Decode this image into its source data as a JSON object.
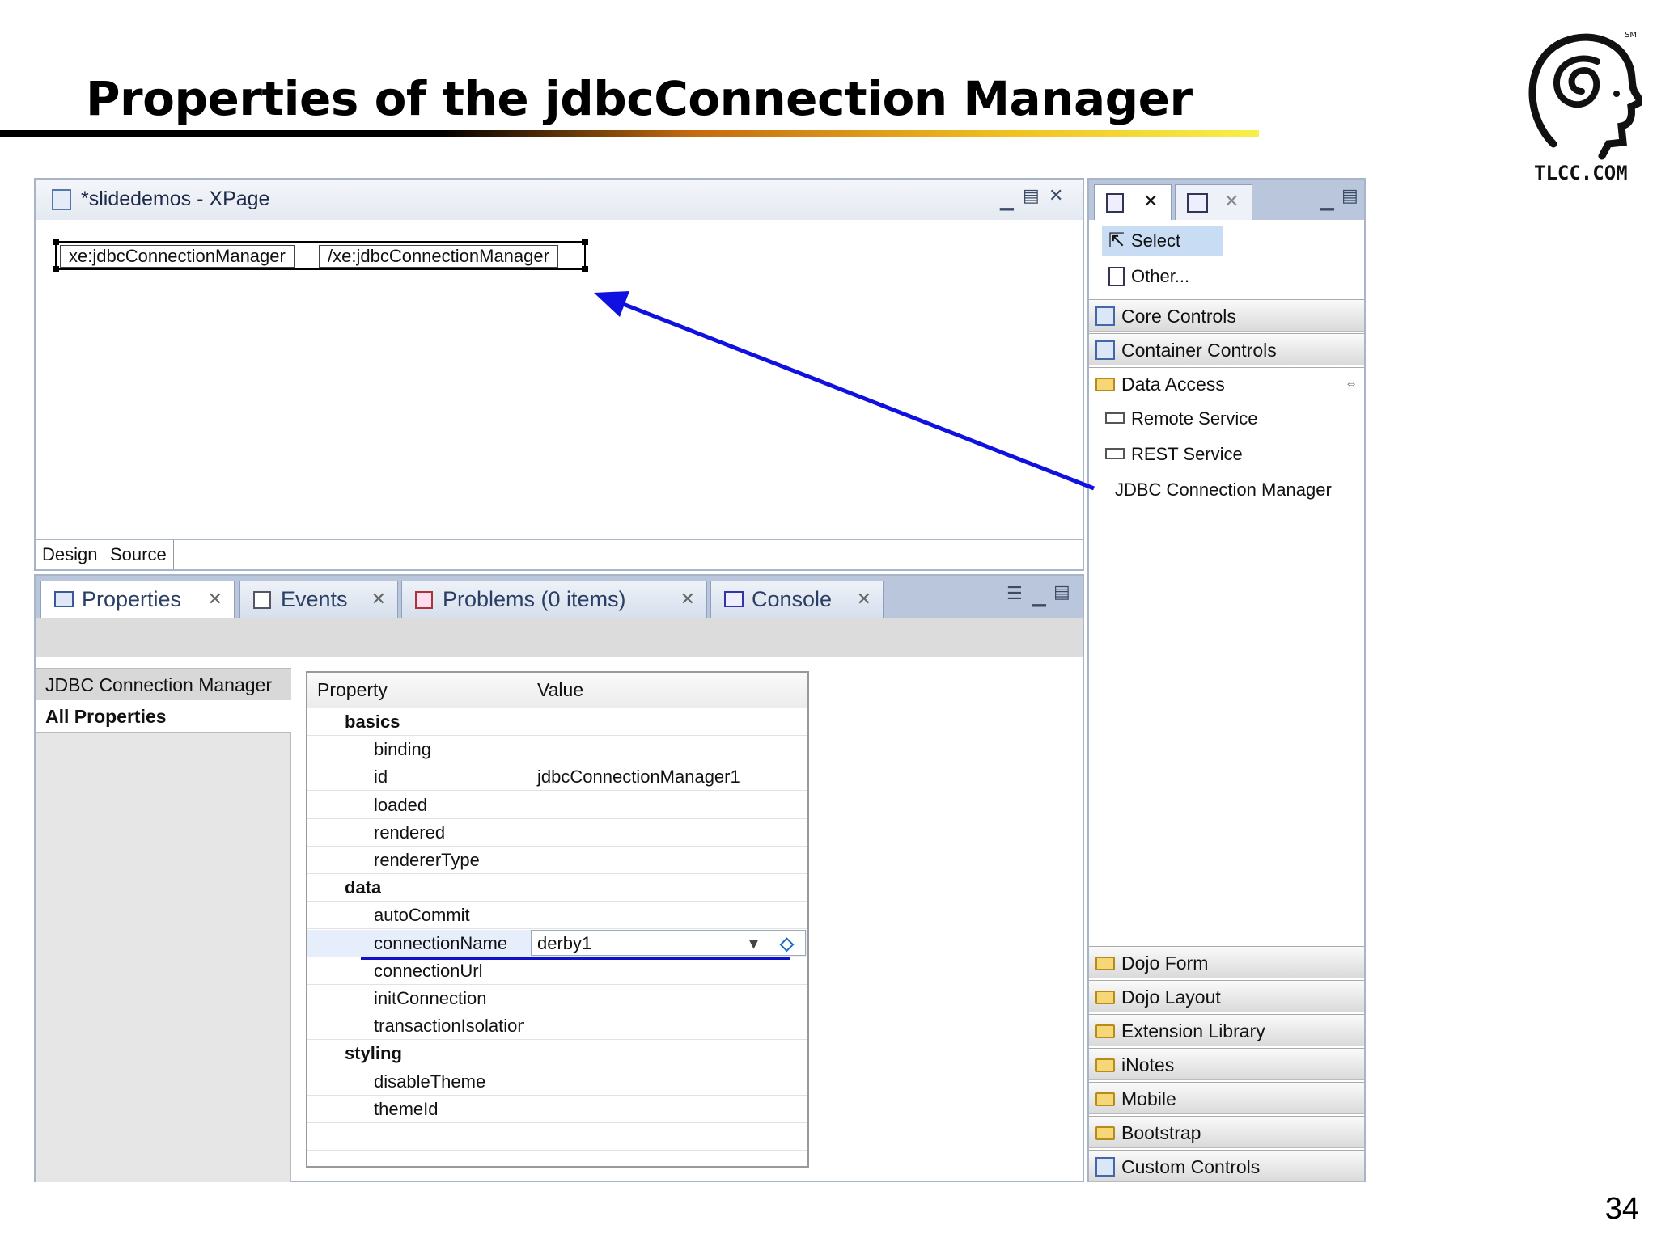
{
  "slide": {
    "title": "Properties of the jdbcConnection Manager",
    "logo_text": "TLCC.COM",
    "page_number": "34"
  },
  "editor": {
    "title": "*slidedemos - XPage",
    "tag_open": "xe:jdbcConnectionManager",
    "tag_close": "/xe:jdbcConnectionManager",
    "tabs": [
      "Design",
      "Source"
    ]
  },
  "bottom_panel": {
    "tabs": [
      {
        "label": "Properties",
        "icon": "properties-icon"
      },
      {
        "label": "Events",
        "icon": "events-icon"
      },
      {
        "label": "Problems (0 items)",
        "icon": "problems-icon"
      },
      {
        "label": "Console",
        "icon": "console-icon"
      }
    ],
    "left_items": [
      "JDBC Connection Manager",
      "All Properties"
    ],
    "table": {
      "header_property": "Property",
      "header_value": "Value",
      "rows": [
        {
          "type": "cat",
          "name": "basics",
          "value": ""
        },
        {
          "type": "sub",
          "name": "binding",
          "value": ""
        },
        {
          "type": "sub",
          "name": "id",
          "value": "jdbcConnectionManager1"
        },
        {
          "type": "sub",
          "name": "loaded",
          "value": ""
        },
        {
          "type": "sub",
          "name": "rendered",
          "value": ""
        },
        {
          "type": "sub",
          "name": "rendererType",
          "value": ""
        },
        {
          "type": "cat",
          "name": "data",
          "value": ""
        },
        {
          "type": "sub",
          "name": "autoCommit",
          "value": ""
        },
        {
          "type": "sub",
          "name": "connectionName",
          "value": "derby1"
        },
        {
          "type": "sub",
          "name": "connectionUrl",
          "value": ""
        },
        {
          "type": "sub",
          "name": "initConnection",
          "value": ""
        },
        {
          "type": "sub",
          "name": "transactionIsolation",
          "value": ""
        },
        {
          "type": "cat",
          "name": "styling",
          "value": ""
        },
        {
          "type": "sub",
          "name": "disableTheme",
          "value": ""
        },
        {
          "type": "sub",
          "name": "themeId",
          "value": ""
        }
      ]
    }
  },
  "palette": {
    "top_items": [
      "Select",
      "Other..."
    ],
    "drawers_top": [
      "Core Controls",
      "Container Controls",
      "Data Access"
    ],
    "data_access_items": [
      "Remote Service",
      "REST Service",
      "JDBC Connection Manager"
    ],
    "drawers_bottom": [
      "Dojo Form",
      "Dojo Layout",
      "Extension Library",
      "iNotes",
      "Mobile",
      "Bootstrap",
      "Custom Controls"
    ]
  },
  "colors": {
    "arrow": "#1010e0",
    "underline": "#1010c8",
    "panel_border": "#a8b4c8",
    "tab_strip": "#b9c6dc"
  }
}
